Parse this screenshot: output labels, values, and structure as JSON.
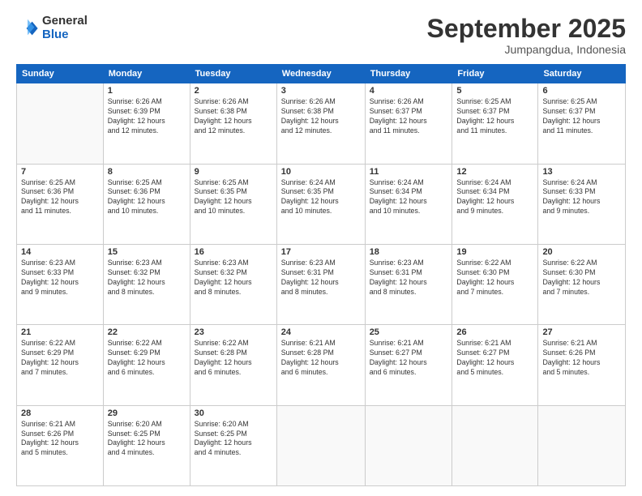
{
  "logo": {
    "general": "General",
    "blue": "Blue"
  },
  "header": {
    "month": "September 2025",
    "location": "Jumpangdua, Indonesia"
  },
  "days_of_week": [
    "Sunday",
    "Monday",
    "Tuesday",
    "Wednesday",
    "Thursday",
    "Friday",
    "Saturday"
  ],
  "weeks": [
    [
      {
        "day": "",
        "sunrise": "",
        "sunset": "",
        "daylight": ""
      },
      {
        "day": "1",
        "sunrise": "Sunrise: 6:26 AM",
        "sunset": "Sunset: 6:39 PM",
        "daylight": "Daylight: 12 hours and 12 minutes."
      },
      {
        "day": "2",
        "sunrise": "Sunrise: 6:26 AM",
        "sunset": "Sunset: 6:38 PM",
        "daylight": "Daylight: 12 hours and 12 minutes."
      },
      {
        "day": "3",
        "sunrise": "Sunrise: 6:26 AM",
        "sunset": "Sunset: 6:38 PM",
        "daylight": "Daylight: 12 hours and 12 minutes."
      },
      {
        "day": "4",
        "sunrise": "Sunrise: 6:26 AM",
        "sunset": "Sunset: 6:37 PM",
        "daylight": "Daylight: 12 hours and 11 minutes."
      },
      {
        "day": "5",
        "sunrise": "Sunrise: 6:25 AM",
        "sunset": "Sunset: 6:37 PM",
        "daylight": "Daylight: 12 hours and 11 minutes."
      },
      {
        "day": "6",
        "sunrise": "Sunrise: 6:25 AM",
        "sunset": "Sunset: 6:37 PM",
        "daylight": "Daylight: 12 hours and 11 minutes."
      }
    ],
    [
      {
        "day": "7",
        "sunrise": "Sunrise: 6:25 AM",
        "sunset": "Sunset: 6:36 PM",
        "daylight": "Daylight: 12 hours and 11 minutes."
      },
      {
        "day": "8",
        "sunrise": "Sunrise: 6:25 AM",
        "sunset": "Sunset: 6:36 PM",
        "daylight": "Daylight: 12 hours and 10 minutes."
      },
      {
        "day": "9",
        "sunrise": "Sunrise: 6:25 AM",
        "sunset": "Sunset: 6:35 PM",
        "daylight": "Daylight: 12 hours and 10 minutes."
      },
      {
        "day": "10",
        "sunrise": "Sunrise: 6:24 AM",
        "sunset": "Sunset: 6:35 PM",
        "daylight": "Daylight: 12 hours and 10 minutes."
      },
      {
        "day": "11",
        "sunrise": "Sunrise: 6:24 AM",
        "sunset": "Sunset: 6:34 PM",
        "daylight": "Daylight: 12 hours and 10 minutes."
      },
      {
        "day": "12",
        "sunrise": "Sunrise: 6:24 AM",
        "sunset": "Sunset: 6:34 PM",
        "daylight": "Daylight: 12 hours and 9 minutes."
      },
      {
        "day": "13",
        "sunrise": "Sunrise: 6:24 AM",
        "sunset": "Sunset: 6:33 PM",
        "daylight": "Daylight: 12 hours and 9 minutes."
      }
    ],
    [
      {
        "day": "14",
        "sunrise": "Sunrise: 6:23 AM",
        "sunset": "Sunset: 6:33 PM",
        "daylight": "Daylight: 12 hours and 9 minutes."
      },
      {
        "day": "15",
        "sunrise": "Sunrise: 6:23 AM",
        "sunset": "Sunset: 6:32 PM",
        "daylight": "Daylight: 12 hours and 8 minutes."
      },
      {
        "day": "16",
        "sunrise": "Sunrise: 6:23 AM",
        "sunset": "Sunset: 6:32 PM",
        "daylight": "Daylight: 12 hours and 8 minutes."
      },
      {
        "day": "17",
        "sunrise": "Sunrise: 6:23 AM",
        "sunset": "Sunset: 6:31 PM",
        "daylight": "Daylight: 12 hours and 8 minutes."
      },
      {
        "day": "18",
        "sunrise": "Sunrise: 6:23 AM",
        "sunset": "Sunset: 6:31 PM",
        "daylight": "Daylight: 12 hours and 8 minutes."
      },
      {
        "day": "19",
        "sunrise": "Sunrise: 6:22 AM",
        "sunset": "Sunset: 6:30 PM",
        "daylight": "Daylight: 12 hours and 7 minutes."
      },
      {
        "day": "20",
        "sunrise": "Sunrise: 6:22 AM",
        "sunset": "Sunset: 6:30 PM",
        "daylight": "Daylight: 12 hours and 7 minutes."
      }
    ],
    [
      {
        "day": "21",
        "sunrise": "Sunrise: 6:22 AM",
        "sunset": "Sunset: 6:29 PM",
        "daylight": "Daylight: 12 hours and 7 minutes."
      },
      {
        "day": "22",
        "sunrise": "Sunrise: 6:22 AM",
        "sunset": "Sunset: 6:29 PM",
        "daylight": "Daylight: 12 hours and 6 minutes."
      },
      {
        "day": "23",
        "sunrise": "Sunrise: 6:22 AM",
        "sunset": "Sunset: 6:28 PM",
        "daylight": "Daylight: 12 hours and 6 minutes."
      },
      {
        "day": "24",
        "sunrise": "Sunrise: 6:21 AM",
        "sunset": "Sunset: 6:28 PM",
        "daylight": "Daylight: 12 hours and 6 minutes."
      },
      {
        "day": "25",
        "sunrise": "Sunrise: 6:21 AM",
        "sunset": "Sunset: 6:27 PM",
        "daylight": "Daylight: 12 hours and 6 minutes."
      },
      {
        "day": "26",
        "sunrise": "Sunrise: 6:21 AM",
        "sunset": "Sunset: 6:27 PM",
        "daylight": "Daylight: 12 hours and 5 minutes."
      },
      {
        "day": "27",
        "sunrise": "Sunrise: 6:21 AM",
        "sunset": "Sunset: 6:26 PM",
        "daylight": "Daylight: 12 hours and 5 minutes."
      }
    ],
    [
      {
        "day": "28",
        "sunrise": "Sunrise: 6:21 AM",
        "sunset": "Sunset: 6:26 PM",
        "daylight": "Daylight: 12 hours and 5 minutes."
      },
      {
        "day": "29",
        "sunrise": "Sunrise: 6:20 AM",
        "sunset": "Sunset: 6:25 PM",
        "daylight": "Daylight: 12 hours and 4 minutes."
      },
      {
        "day": "30",
        "sunrise": "Sunrise: 6:20 AM",
        "sunset": "Sunset: 6:25 PM",
        "daylight": "Daylight: 12 hours and 4 minutes."
      },
      {
        "day": "",
        "sunrise": "",
        "sunset": "",
        "daylight": ""
      },
      {
        "day": "",
        "sunrise": "",
        "sunset": "",
        "daylight": ""
      },
      {
        "day": "",
        "sunrise": "",
        "sunset": "",
        "daylight": ""
      },
      {
        "day": "",
        "sunrise": "",
        "sunset": "",
        "daylight": ""
      }
    ]
  ]
}
